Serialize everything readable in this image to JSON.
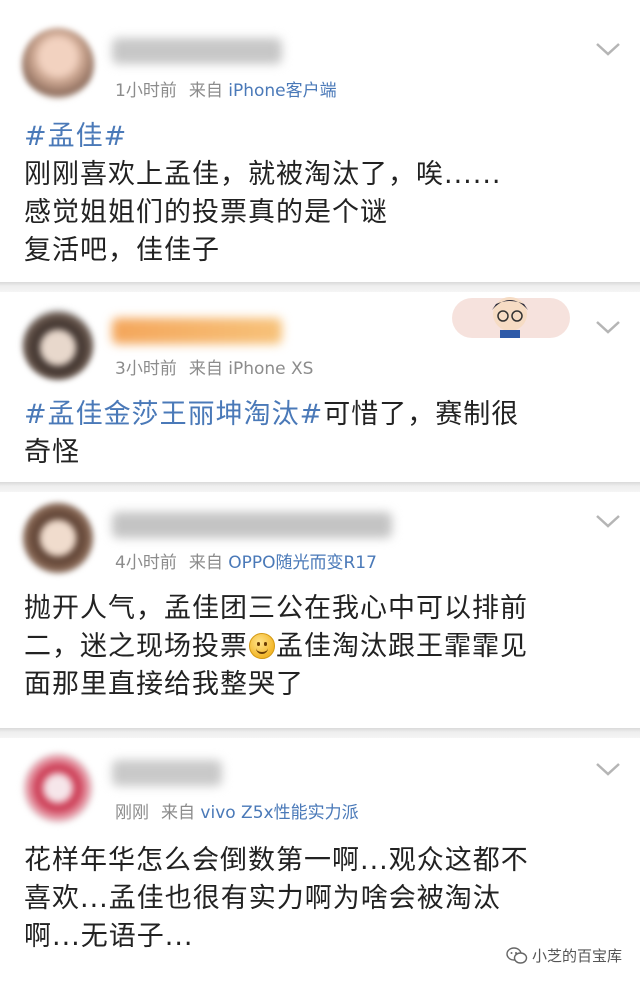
{
  "posts": [
    {
      "time": "1小时前",
      "from_label": "来自",
      "source": "iPhone客户端",
      "lines": [
        [
          {
            "topic": true,
            "text": "#孟佳#"
          }
        ],
        [
          {
            "text": "刚刚喜欢上孟佳，就被淘汰了，唉......"
          }
        ],
        [
          {
            "text": "感觉姐姐们的投票真的是个谜"
          }
        ],
        [
          {
            "text": "复活吧，佳佳子"
          }
        ]
      ]
    },
    {
      "time": "3小时前",
      "from_label": "来自",
      "source": "iPhone XS",
      "lines": [
        [
          {
            "topic": true,
            "text": "#孟佳金莎王丽坤淘汰#"
          },
          {
            "text": "可惜了，赛制很"
          }
        ],
        [
          {
            "text": "奇怪"
          }
        ]
      ]
    },
    {
      "time": "4小时前",
      "from_label": "来自",
      "source": "OPPO随光而变R17",
      "lines": [
        [
          {
            "text": "抛开人气，孟佳团三公在我心中可以排前"
          }
        ],
        [
          {
            "text": "二，迷之现场投票"
          },
          {
            "emoji": "smiley"
          },
          {
            "text": "孟佳淘汰跟王霏霏见"
          }
        ],
        [
          {
            "text": "面那里直接给我整哭了"
          }
        ]
      ]
    },
    {
      "time": "刚刚",
      "from_label": "来自",
      "source": "vivo Z5x性能实力派",
      "lines": [
        [
          {
            "text": "花样年华怎么会倒数第一啊...观众这都不"
          }
        ],
        [
          {
            "text": "喜欢...孟佳也很有实力啊为啥会被淘汰"
          }
        ],
        [
          {
            "text": "啊...无语子..."
          }
        ]
      ]
    }
  ],
  "watermark": "小芝的百宝库",
  "icons": {
    "more": "chevron-down-icon",
    "emoji": "smiley-icon",
    "watermark": "wechat-icon"
  },
  "colors": {
    "link": "#4a79b8",
    "meta": "#8c8c8c",
    "text": "#222222"
  }
}
